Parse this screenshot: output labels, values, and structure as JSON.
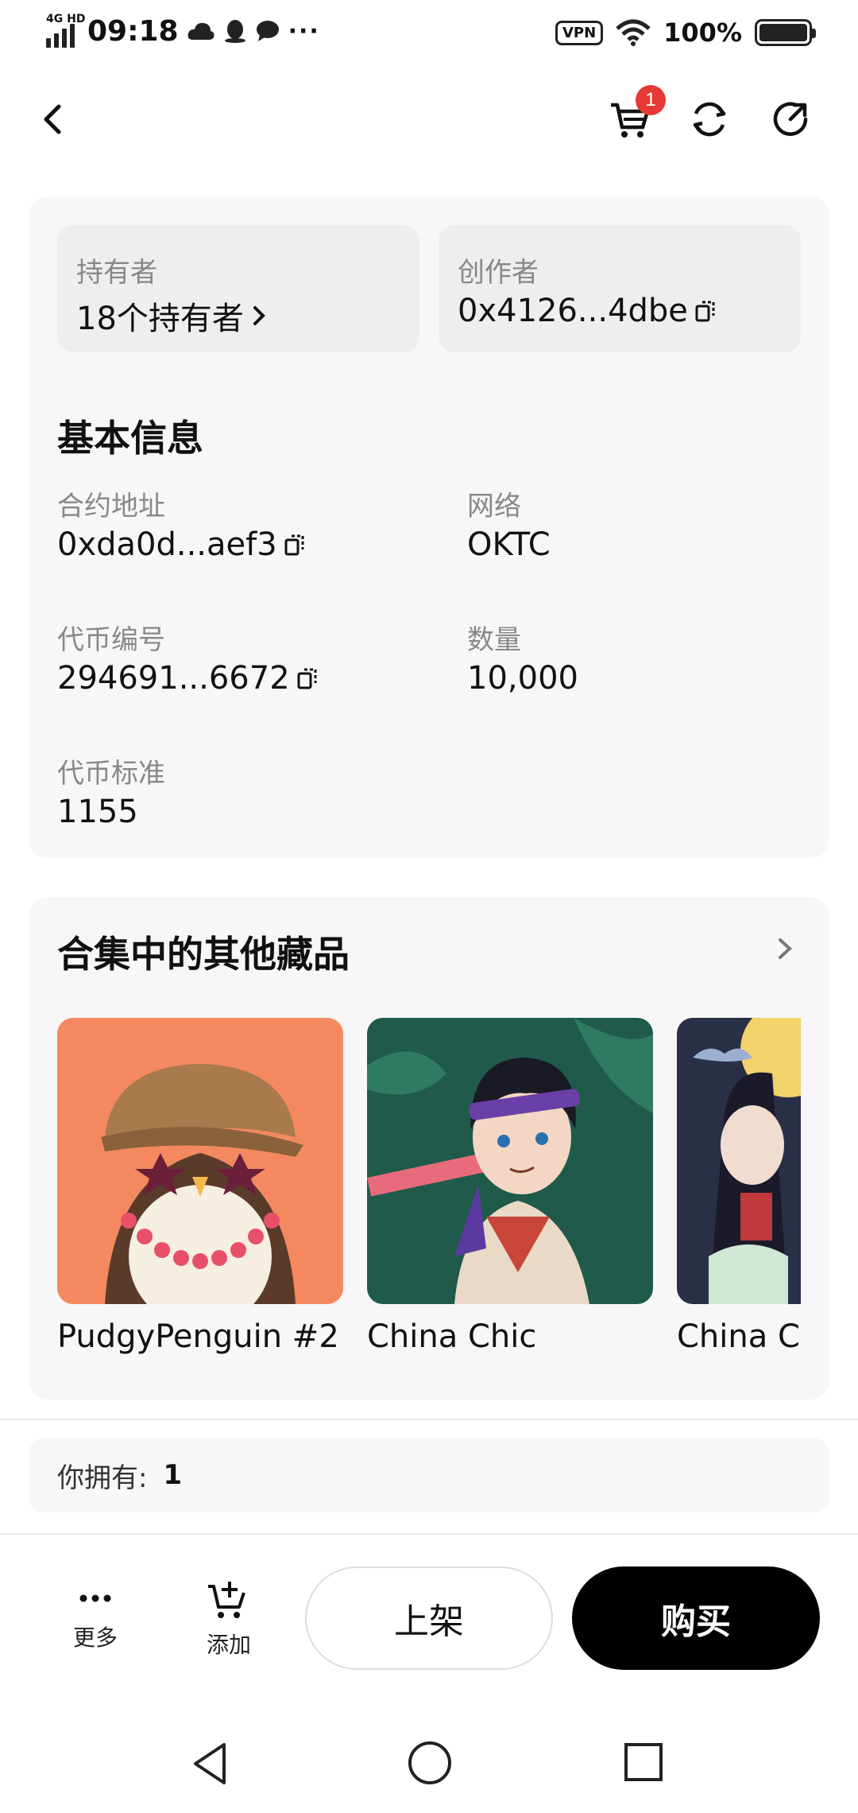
{
  "status_bar": {
    "network": "4G HD",
    "time": "09:18",
    "more": "···",
    "vpn": "VPN",
    "battery": "100%"
  },
  "header": {
    "cart_badge": "1"
  },
  "owners": {
    "label": "持有者",
    "value": "18个持有者"
  },
  "creator": {
    "label": "创作者",
    "value": "0x4126...4dbe"
  },
  "basic_info": {
    "title": "基本信息",
    "fields": [
      {
        "label": "合约地址",
        "value": "0xda0d...aef3",
        "copyable": true
      },
      {
        "label": "网络",
        "value": "OKTC",
        "copyable": false
      },
      {
        "label": "代币编号",
        "value": "294691...6672",
        "copyable": true
      },
      {
        "label": "数量",
        "value": "10,000",
        "copyable": false
      },
      {
        "label": "代币标准",
        "value": "1155",
        "copyable": false
      }
    ]
  },
  "collection": {
    "title": "合集中的其他藏品",
    "items": [
      {
        "name": "PudgyPenguin  #2",
        "bg": "#f4895f"
      },
      {
        "name": "China Chic",
        "bg": "#1f5a4a"
      },
      {
        "name": "China Chic",
        "bg": "#2a2f48"
      }
    ]
  },
  "ownership": {
    "label": "你拥有:",
    "value": "1"
  },
  "actions": {
    "more": "更多",
    "add": "添加",
    "list": "上架",
    "buy": "购买"
  },
  "colors": {
    "badge": "#e53935",
    "buy_bg": "#000000",
    "card_bg": "#f7f7f7"
  }
}
